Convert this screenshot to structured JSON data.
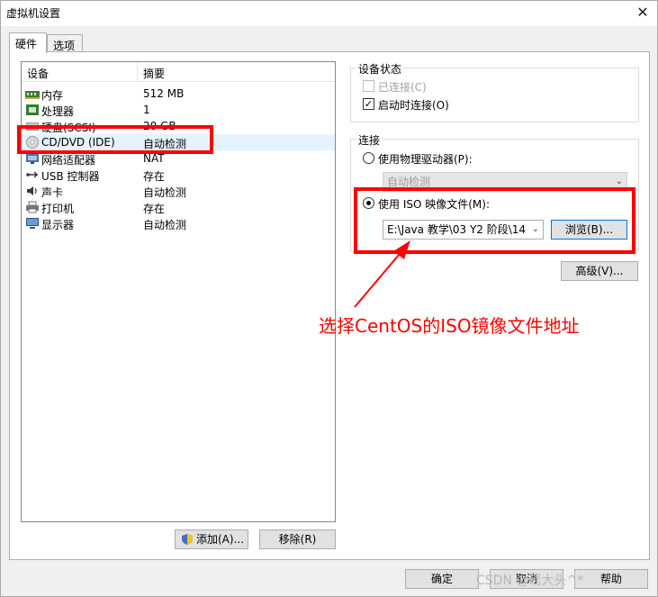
{
  "window": {
    "title": "虚拟机设置",
    "close_glyph": "✕"
  },
  "tabs": [
    {
      "label": "硬件",
      "active": true
    },
    {
      "label": "选项",
      "active": false
    }
  ],
  "device_list": {
    "columns": [
      "设备",
      "摘要"
    ],
    "rows": [
      {
        "name": "内存",
        "summary": "512 MB",
        "icon": "memory-icon"
      },
      {
        "name": "处理器",
        "summary": "1",
        "icon": "processor-icon"
      },
      {
        "name": "硬盘(SCSI)",
        "summary": "20 GB",
        "icon": "hard-disk-icon"
      },
      {
        "name": "CD/DVD (IDE)",
        "summary": "自动检测",
        "icon": "cd-dvd-icon",
        "selected": true
      },
      {
        "name": "网络适配器",
        "summary": "NAT",
        "icon": "network-adapter-icon"
      },
      {
        "name": "USB 控制器",
        "summary": "存在",
        "icon": "usb-icon"
      },
      {
        "name": "声卡",
        "summary": "自动检测",
        "icon": "sound-card-icon"
      },
      {
        "name": "打印机",
        "summary": "存在",
        "icon": "printer-icon"
      },
      {
        "name": "显示器",
        "summary": "自动检测",
        "icon": "display-icon"
      }
    ]
  },
  "device_buttons": {
    "add": "添加(A)...",
    "remove": "移除(R)"
  },
  "device_status": {
    "title": "设备状态",
    "connected": {
      "label": "已连接(C)",
      "checked": false,
      "disabled": true
    },
    "connect_at_power_on": {
      "label": "启动时连接(O)",
      "checked": true
    }
  },
  "connection": {
    "title": "连接",
    "physical_drive": {
      "label": "使用物理驱动器(P):",
      "selected": false,
      "combo_value": "自动检测"
    },
    "iso_image": {
      "label": "使用 ISO 映像文件(M):",
      "selected": true,
      "path_value": "E:\\Java 教学\\03 Y2 阶段\\14"
    },
    "browse_label": "浏览(B)...",
    "advanced_label": "高级(V)..."
  },
  "annotation": {
    "text": "选择CentOS的ISO镜像文件地址",
    "color": "#ff0000"
  },
  "footer": {
    "ok": "确定",
    "cancel": "取消",
    "help": "帮助"
  },
  "watermark": "CSDN @瑶大头^*"
}
